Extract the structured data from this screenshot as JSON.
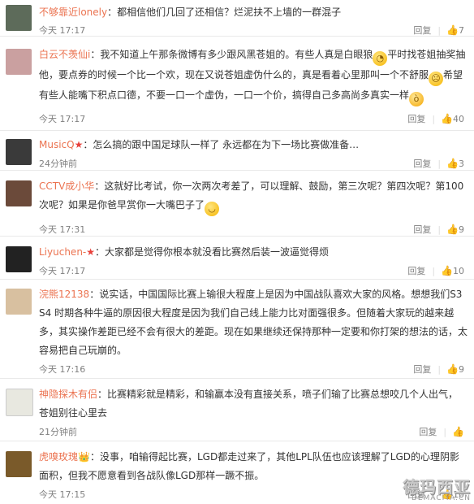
{
  "reply_label": "回复",
  "comments": [
    {
      "user": "不够靠近lonely",
      "badge": "",
      "text": "：都相信他们几回了还相信？烂泥扶不上墙的一群混子",
      "time": "今天 17:17",
      "likes": "7",
      "avatar_color": "#5d6b5a"
    },
    {
      "user": "白云不羡仙i",
      "badge": "",
      "text_1": "：我不知道上午那条微博有多少跟风黑苍姐的。有些人真是白眼狼",
      "text_2": "平时找苍姐抽奖抽他，要点券的时候一个比一个欢，现在又说苍姐虚伪什么的，真是看着心里那叫一个不舒服",
      "text_3": "希望有些人能嘴下积点口德，不要一口一个虚伪，一口一个价，搞得自己多高尚多真实一样",
      "time": "今天 17:17",
      "likes": "40",
      "avatar_color": "#caa0a0"
    },
    {
      "user": "MusicQ",
      "badge": "★",
      "text": "：怎么搞的跟中国足球队一样了 永远都在为下一场比赛做准备…",
      "time": "24分钟前",
      "likes": "3",
      "avatar_color": "#3a3a3a"
    },
    {
      "user": "CCTV成小华",
      "badge": "",
      "text_1": "：这就好比考试，你一次两次考差了，可以理解、鼓励，第三次呢？第四次呢？第100次呢？如果是你爸早赏你一大嘴巴子了",
      "time": "今天 17:31",
      "likes": "9",
      "avatar_color": "#6b4a3a"
    },
    {
      "user": "Liyuchen-",
      "badge": "★",
      "text": "：大家都是觉得你根本就没看比赛然后装一波逼觉得烦",
      "time": "今天 17:17",
      "likes": "10",
      "avatar_color": "#222222"
    },
    {
      "user": "浣熊12138",
      "badge": "",
      "text": "：说实话，中国国际比赛上输很大程度上是因为中国战队喜欢大家的风格。想想我们S3 S4 时期各种牛逼的原因很大程度是因为我们自己线上能力比对面强很多。但随着大家玩的越来越多，其实操作差距已经不会有很大的差距。现在如果继续还保持那种一定要和你打架的想法的话，太容易把自己玩崩的。",
      "time": "今天 17:16",
      "likes": "9",
      "avatar_color": "#d8c0a0"
    },
    {
      "user": "神隐探木有侣",
      "badge": "",
      "text": "：比赛精彩就是精彩，和输赢本没有直接关系，喷子们输了比赛总想咬几个人出气，苍姐别往心里去",
      "time": "21分钟前",
      "likes": "",
      "avatar_color": "#e8e8e0"
    },
    {
      "user": "虎嗅玫瑰",
      "badge": "👑",
      "text": "：没事，咱输得起比赛，LGD都走过来了，其他LPL队伍也应该理解了LGD的心理阴影面积，但我不愿意看到各战队像LGD那样一蹶不振。",
      "time": "今天 17:15",
      "likes": "10",
      "avatar_color": "#7a5a2a"
    }
  ],
  "watermark": {
    "title": "德玛西亚",
    "sub": "DEMACIYA.CN"
  }
}
